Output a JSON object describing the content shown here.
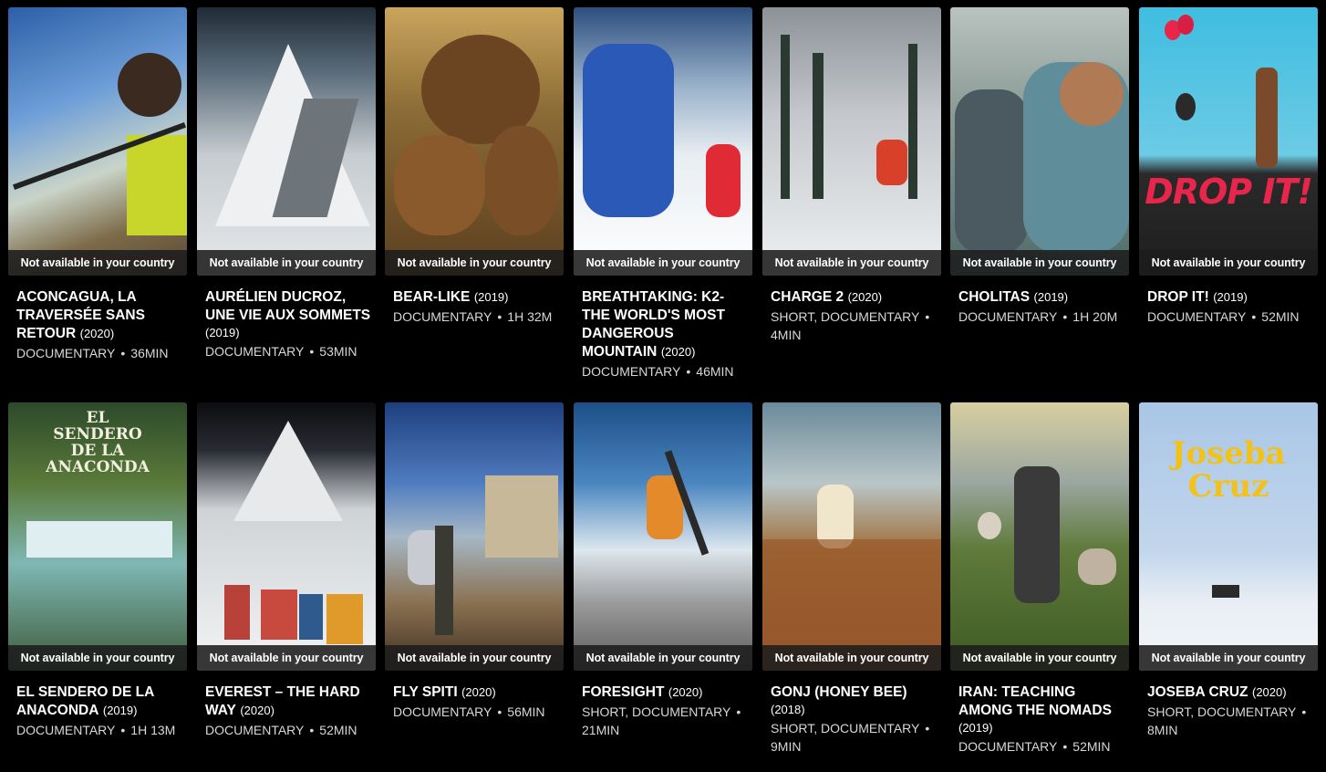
{
  "availability_label": "Not available in your country",
  "separator": "•",
  "films": [
    {
      "title": "ACONCAGUA, LA TRAVERSÉE SANS RETOUR",
      "year": "(2020)",
      "genre": "DOCUMENTARY",
      "duration": "36MIN"
    },
    {
      "title": "AURÉLIEN DUCROZ, UNE VIE AUX SOMMETS",
      "year": "(2019)",
      "genre": "DOCUMENTARY",
      "duration": "53MIN"
    },
    {
      "title": "BEAR-LIKE",
      "year": "(2019)",
      "genre": "DOCUMENTARY",
      "duration": "1H 32M"
    },
    {
      "title": "BREATHTAKING: K2- THE WORLD'S MOST DANGEROUS MOUNTAIN",
      "year": "(2020)",
      "genre": "DOCUMENTARY",
      "duration": "46MIN"
    },
    {
      "title": "CHARGE 2",
      "year": "(2020)",
      "genre": "SHORT, DOCUMENTARY",
      "duration": "4MIN"
    },
    {
      "title": "CHOLITAS",
      "year": "(2019)",
      "genre": "DOCUMENTARY",
      "duration": "1H 20M"
    },
    {
      "title": "DROP IT!",
      "year": "(2019)",
      "genre": "DOCUMENTARY",
      "duration": "52MIN"
    },
    {
      "title": "EL SENDERO DE LA ANACONDA",
      "year": "(2019)",
      "genre": "DOCUMENTARY",
      "duration": "1H 13M"
    },
    {
      "title": "EVEREST – THE HARD WAY",
      "year": "(2020)",
      "genre": "DOCUMENTARY",
      "duration": "52MIN"
    },
    {
      "title": "FLY SPITI",
      "year": "(2020)",
      "genre": "DOCUMENTARY",
      "duration": "56MIN"
    },
    {
      "title": "FORESIGHT",
      "year": "(2020)",
      "genre": "SHORT, DOCUMENTARY",
      "duration": "21MIN"
    },
    {
      "title": "GONJ (HONEY BEE)",
      "year": "(2018)",
      "genre": "SHORT, DOCUMENTARY",
      "duration": "9MIN"
    },
    {
      "title": "IRAN: TEACHING AMONG THE NOMADS",
      "year": "(2019)",
      "genre": "DOCUMENTARY",
      "duration": "52MIN"
    },
    {
      "title": "JOSEBA CRUZ",
      "year": "(2020)",
      "genre": "SHORT, DOCUMENTARY",
      "duration": "8MIN"
    }
  ],
  "poster_text": {
    "drop_it": "DROP IT!",
    "anaconda_line1": "EL",
    "anaconda_line2": "SENDERO",
    "anaconda_line3": "DE LA",
    "anaconda_line4": "ANACONDA",
    "joseba_line1": "Joseba",
    "joseba_line2": "Cruz"
  },
  "colors": {
    "background": "#000000",
    "overlay": "#1c1c1c",
    "drop_it_red": "#e8254a",
    "joseba_yellow": "#f2c21a"
  }
}
